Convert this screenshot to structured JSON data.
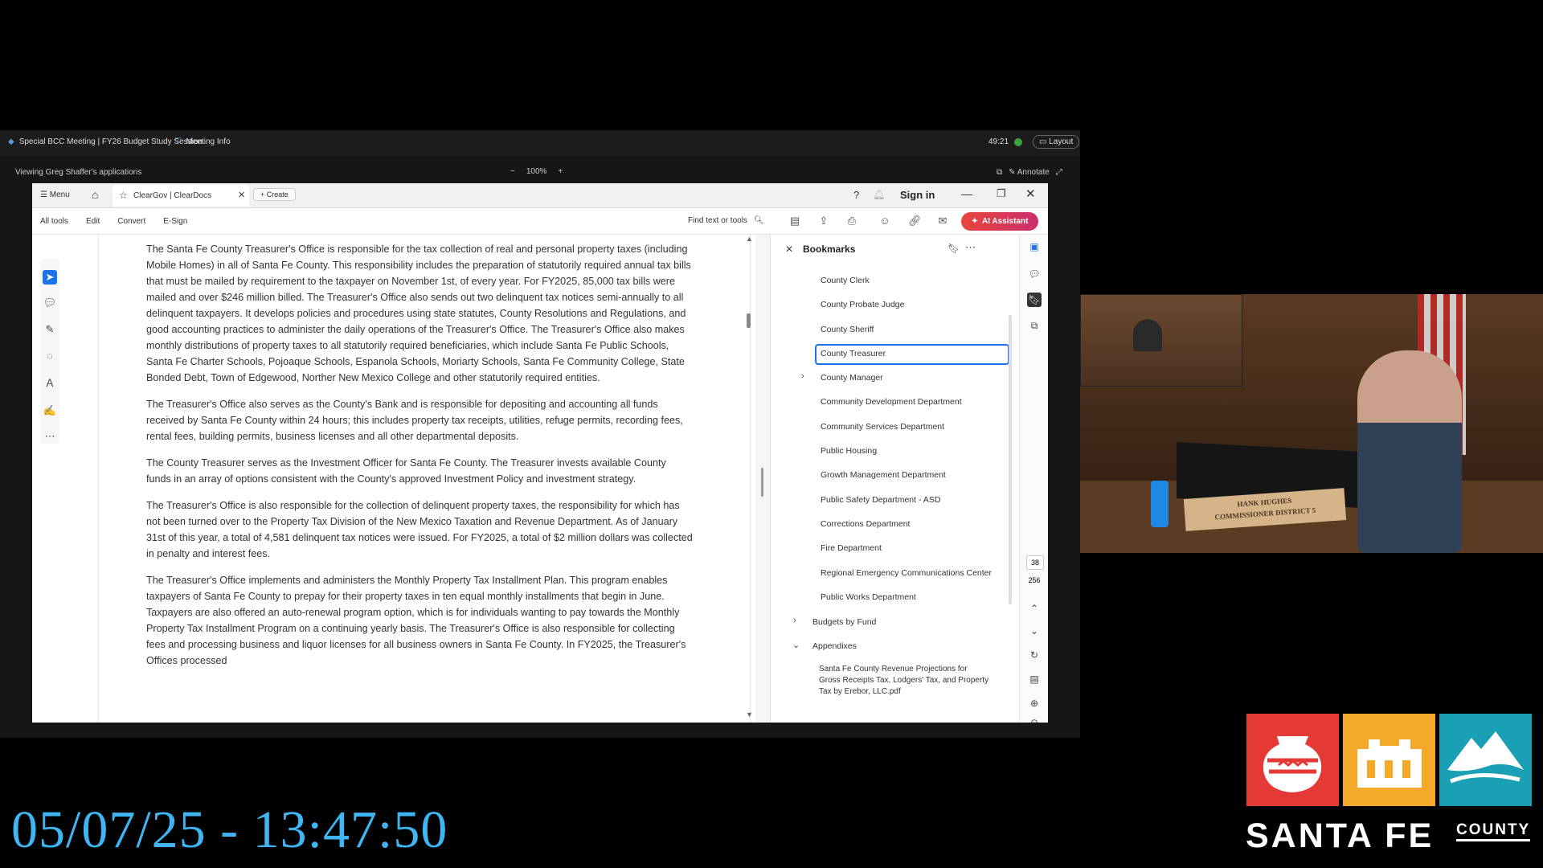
{
  "meeting": {
    "title": "Special BCC Meeting | FY26 Budget Study Session",
    "info": "Meeting Info",
    "timer": "49:21",
    "layout_label": "Layout",
    "share_title": "Viewing Greg Shaffer's applications",
    "zoom": "100%",
    "annotate_label": "Annotate"
  },
  "acrobat": {
    "menu_label": "Menu",
    "tab_title": "ClearGov | ClearDocs",
    "create_label": "Create",
    "signin_label": "Sign in",
    "menus": [
      "All tools",
      "Edit",
      "Convert",
      "E-Sign"
    ],
    "find_placeholder": "Find text or tools",
    "ai_label": "AI Assistant"
  },
  "document": {
    "paragraphs": [
      "The Santa Fe County Treasurer's Office is responsible for the tax collection of real and personal property taxes (including Mobile Homes) in all of Santa Fe County. This responsibility includes the preparation of statutorily required annual tax bills that must be mailed by requirement to the taxpayer on November 1st, of every year. For FY2025, 85,000 tax bills were mailed and over $246 million billed. The Treasurer's Office also sends out two delinquent tax notices semi-annually to all delinquent taxpayers. It develops policies and procedures using state statutes, County Resolutions and Regulations, and good accounting practices to administer the daily operations of the Treasurer's Office. The Treasurer's Office also makes monthly distributions of property taxes to all statutorily required beneficiaries, which include Santa Fe Public Schools, Santa Fe Charter Schools, Pojoaque Schools, Espanola Schools, Moriarty Schools, Santa Fe Community College, State Bonded Debt, Town of Edgewood, Norther New Mexico College and other statutorily required entities.",
      "The Treasurer's Office also serves as the County's Bank and is responsible for depositing and accounting all funds received by Santa Fe County within 24 hours; this includes property tax receipts, utilities, refuge permits, recording fees, rental fees, building permits, business licenses and all other departmental deposits.",
      "The County Treasurer serves as the Investment Officer for Santa Fe County. The Treasurer invests available County funds in an array of options consistent with the County's approved Investment Policy and investment strategy.",
      "The Treasurer's Office is also responsible for the collection of delinquent property taxes, the responsibility for which has not been turned over to the Property Tax Division of the New Mexico Taxation and Revenue Department. As of January 31st of this year, a total of 4,581 delinquent tax notices were issued. For FY2025, a total of $2 million dollars was collected in penalty and interest fees.",
      "The Treasurer's Office implements and administers the Monthly Property Tax Installment Plan. This program enables taxpayers of Santa Fe County to prepay for their property taxes in ten equal monthly installments that begin in June. Taxpayers are also offered an auto-renewal program option, which is for individuals wanting to pay towards the Monthly Property Tax Installment Program on a continuing yearly basis. The Treasurer's Office is also responsible for collecting fees and processing business and liquor licenses for all business owners in Santa Fe County. In FY2025, the Treasurer's Offices processed"
    ]
  },
  "bookmarks": {
    "title": "Bookmarks",
    "items": [
      "County Clerk",
      "County Probate Judge",
      "County Sheriff",
      "County Treasurer",
      "County Manager",
      "Community Development Department",
      "Community Services Department",
      "Public Housing",
      "Growth Management Department",
      "Public Safety Department - ASD",
      "Corrections Department",
      "Fire Department",
      "Regional Emergency Communications Center",
      "Public Works Department",
      "Budgets by Fund",
      "Appendixes",
      "Santa Fe County Revenue Projections for Gross Receipts Tax, Lodgers' Tax, and Property Tax by Erebor, LLC.pdf"
    ],
    "selected": "County Treasurer"
  },
  "page_nav": {
    "current": "38",
    "total": "256"
  },
  "camera": {
    "nameplate_line1": "HANK HUGHES",
    "nameplate_line2": "COMMISSIONER DISTRICT 5"
  },
  "broadcast": {
    "timestamp": "05/07/25 - 13:47:50"
  },
  "logo": {
    "name": "SANTA FE",
    "suffix": "COUNTY"
  },
  "colors": {
    "selection": "#1a73e8",
    "timestamp": "#3fb5f2",
    "ai_button": "#e8453c"
  }
}
